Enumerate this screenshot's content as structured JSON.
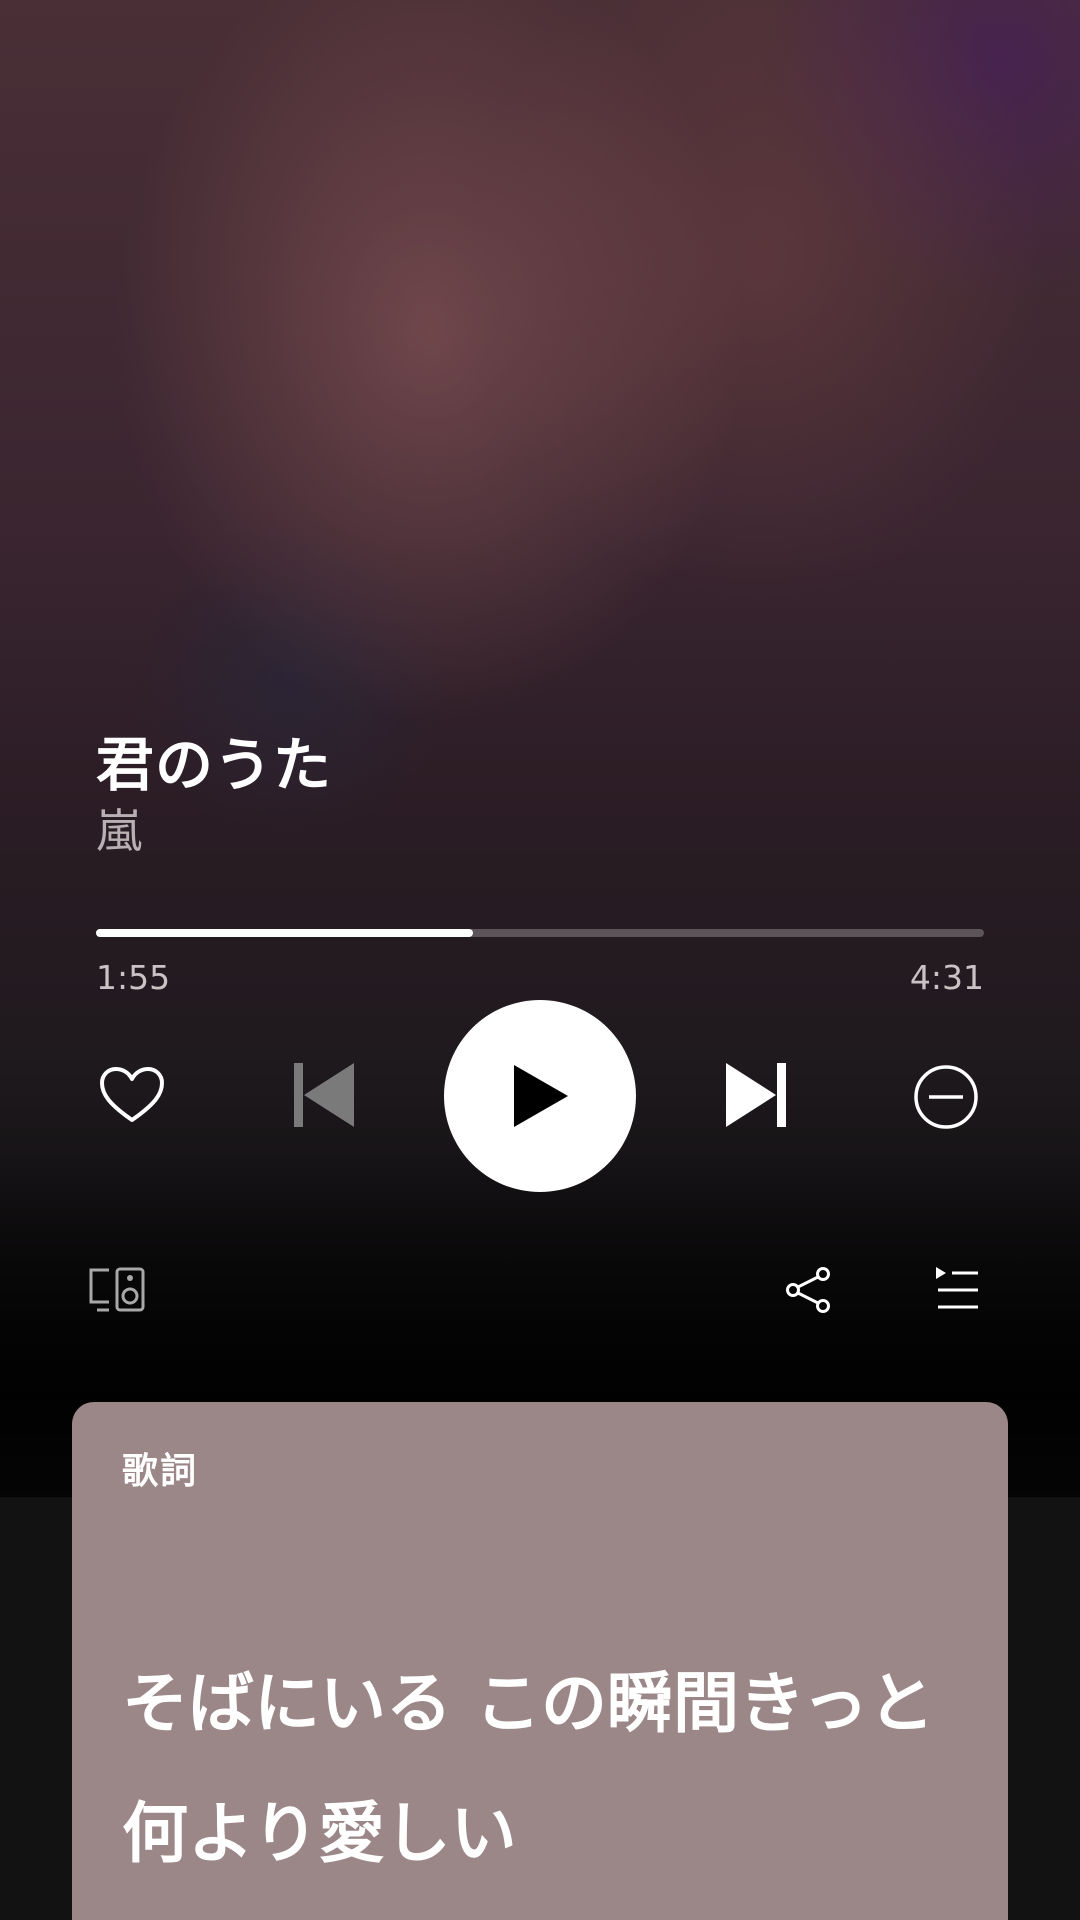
{
  "track": {
    "title": "君のうた",
    "artist": "嵐"
  },
  "playback": {
    "elapsed": "1:55",
    "duration": "4:31",
    "progress_fraction": 0.425,
    "state": "paused"
  },
  "controls": {
    "icons": {
      "like": "heart-icon",
      "previous": "skip-previous-icon",
      "play": "play-icon",
      "next": "skip-next-icon",
      "hide": "minus-circle-icon",
      "devices": "devices-icon",
      "share": "share-icon",
      "queue": "queue-icon"
    }
  },
  "lyrics": {
    "header": "歌詞",
    "lines": [
      "そばにいる この瞬間きっと",
      "何より愛しい"
    ]
  },
  "colors": {
    "accent": "#ffffff",
    "lyrics_card_bg": "#9c8788",
    "disabled_control": "#7a7a7a"
  }
}
